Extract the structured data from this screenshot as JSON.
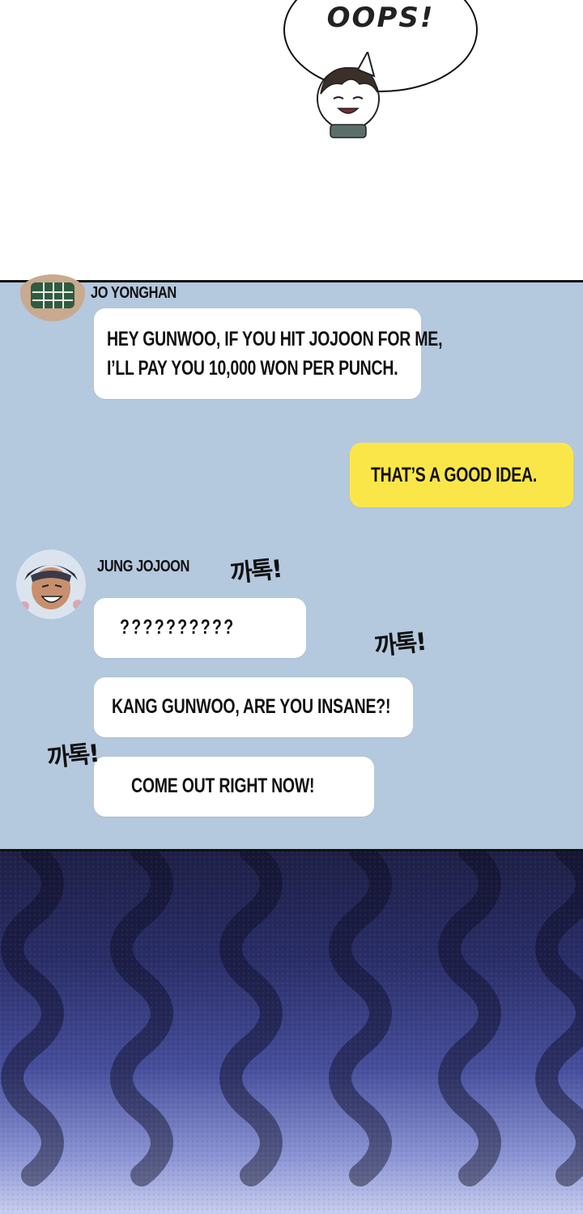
{
  "top_panel": {
    "speech_text": "OOPS!"
  },
  "chat": {
    "messages": [
      {
        "sender": "JO YONGHAN",
        "lines": [
          "HEY GUNWOO, IF YOU HIT JOJOON FOR ME,",
          "I’LL PAY YOU 10,000 WON PER PUNCH."
        ]
      },
      {
        "sender": "",
        "lines": [
          "THAT’S A GOOD IDEA."
        ]
      },
      {
        "sender": "JUNG JOJOON",
        "lines": [
          "??????????"
        ]
      },
      {
        "sender": "",
        "lines": [
          "KANG GUNWOO, ARE YOU INSANE?!"
        ]
      },
      {
        "sender": "",
        "lines": [
          "COME OUT RIGHT NOW!"
        ]
      }
    ],
    "sound_effects": [
      "까톡!",
      "까톡!",
      "까톡!"
    ],
    "colors": {
      "chat_background": "#b4c8de",
      "my_bubble": "#fbe64a",
      "other_bubble": "#ffffff"
    }
  }
}
